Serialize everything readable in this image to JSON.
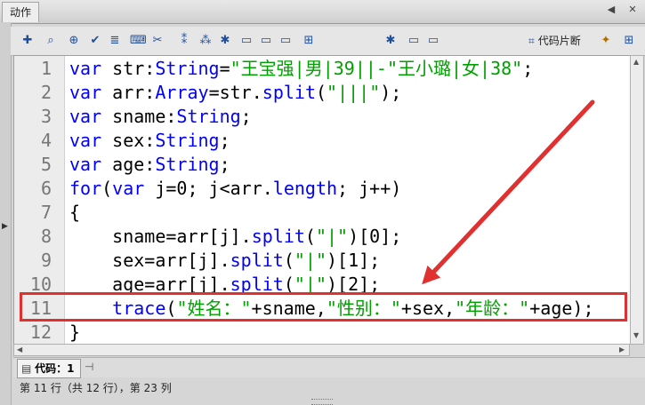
{
  "panel": {
    "tab_label": "动作"
  },
  "toolbar": {
    "icons": [
      "plus-icon",
      "find-icon",
      "target-icon",
      "check-icon",
      "format-icon",
      "debug-icon",
      "wrench-icon",
      "collapse-icon",
      "collapse-selection-icon",
      "expand-icon",
      "comment-icon",
      "uncomment-icon",
      "comment-line-icon",
      "snippet-insert-icon",
      "collapse-2-icon",
      "comment-2-icon",
      "comment-3-icon",
      "code-snippet-icon",
      "magic-wand-icon",
      "help-icon"
    ],
    "snippets_label": "代码片断"
  },
  "editor": {
    "line_numbers": [
      "1",
      "2",
      "3",
      "4",
      "5",
      "6",
      "7",
      "8",
      "9",
      "10",
      "11",
      "12"
    ],
    "highlighted_line": 11
  },
  "code": {
    "l1": {
      "kw": "var",
      "a": " str:",
      "type": "String",
      "b": "=",
      "s": "\"王宝强|男|39||-\"王小璐|女|38\"",
      "c": ";"
    },
    "l2": {
      "kw": "var",
      "a": " arr:",
      "type": "Array",
      "b": "=str.",
      "fn": "split",
      "c": "(",
      "s": "\"|||\"",
      "d": ");"
    },
    "l3": {
      "kw": "var",
      "a": " sname:",
      "type": "String",
      "b": ";"
    },
    "l4": {
      "kw": "var",
      "a": " sex:",
      "type": "String",
      "b": ";"
    },
    "l5": {
      "kw": "var",
      "a": " age:",
      "type": "String",
      "b": ";"
    },
    "l6": {
      "kw": "for",
      "a": "(",
      "kw2": "var",
      "b": " j=0; j<arr.",
      "prop": "length",
      "c": "; j++)"
    },
    "l7": {
      "a": "{"
    },
    "l8": {
      "a": "    sname=arr[j].",
      "fn": "split",
      "b": "(",
      "s": "\"|\"",
      "c": ")[0];"
    },
    "l9": {
      "a": "    sex=arr[j].",
      "fn": "split",
      "b": "(",
      "s": "\"|\"",
      "c": ")[1];"
    },
    "l10": {
      "a": "    age=arr[j].",
      "fn": "split",
      "b": "(",
      "s": "\"|\"",
      "c": ")[2];"
    },
    "l11": {
      "a": "    ",
      "fn": "trace",
      "b": "(",
      "s1": "\"姓名：\"",
      "c": "+sname,",
      "s2": "\"性别：\"",
      "d": "+sex,",
      "s3": "\"年龄：\"",
      "e": "+age);"
    },
    "l12": {
      "a": "}"
    }
  },
  "bottom_tab": {
    "label": "代码：1"
  },
  "status": {
    "text": "第 11 行（共 12 行），第 23 列"
  },
  "colors": {
    "keyword": "#0000ff",
    "string": "#00a000",
    "highlight_border": "#e03030",
    "arrow": "#e03030"
  }
}
